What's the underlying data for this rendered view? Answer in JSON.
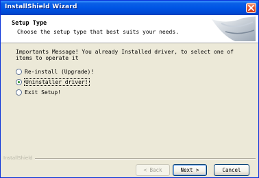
{
  "window": {
    "title": "InstallShield Wizard",
    "close_icon": "close-icon"
  },
  "header": {
    "title": "Setup Type",
    "subtitle": "Choose the setup type that best suits your needs."
  },
  "message": "Importants Message! You already Installed driver, to select one of items to operate it",
  "options": [
    {
      "label": "Re-install (Upgrade)!",
      "checked": false
    },
    {
      "label": "Uninstaller driver!",
      "checked": true
    },
    {
      "label": "Exit Setup!",
      "checked": false
    }
  ],
  "footer": {
    "brand": "InstallShield",
    "back_label": "< Back",
    "next_label": "Next >",
    "cancel_label": "Cancel"
  },
  "colors": {
    "titlebar": "#0055e5",
    "dialog_bg": "#ece9d8"
  }
}
